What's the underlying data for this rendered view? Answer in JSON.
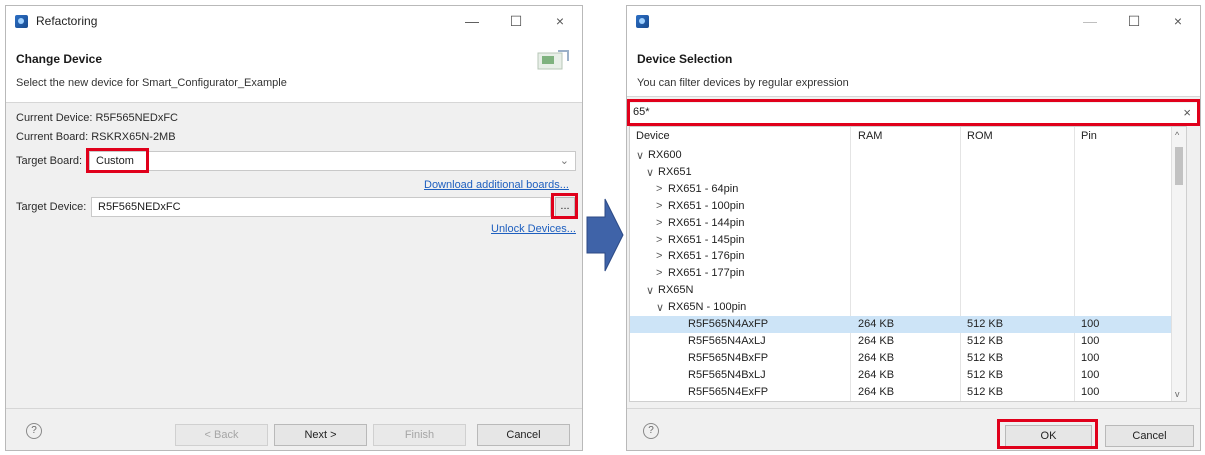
{
  "left_dialog": {
    "title": "Refactoring",
    "heading": "Change Device",
    "subtitle": "Select the new device for Smart_Configurator_Example",
    "current_device_label": "Current Device: R5F565NEDxFC",
    "current_board_label": "Current Board: RSKRX65N-2MB",
    "target_board_label": "Target Board:",
    "target_board_value": "Custom",
    "download_link": "Download additional boards...",
    "target_device_label": "Target Device:",
    "target_device_value": "R5F565NEDxFC",
    "browse_label": "...",
    "unlock_link": "Unlock Devices...",
    "buttons": {
      "back": "< Back",
      "next": "Next >",
      "finish": "Finish",
      "cancel": "Cancel"
    },
    "help_icon": "?"
  },
  "right_dialog": {
    "heading": "Device Selection",
    "subtitle": "You can filter devices by regular expression",
    "filter_value": "65*",
    "clear_label": "×",
    "columns": [
      "Device",
      "RAM",
      "ROM",
      "Pin"
    ],
    "rows": [
      {
        "device": "RX600",
        "ram": "",
        "rom": "",
        "pin": "",
        "indent": 0,
        "expander": "∨"
      },
      {
        "device": "RX651",
        "ram": "",
        "rom": "",
        "pin": "",
        "indent": 1,
        "expander": "∨"
      },
      {
        "device": "RX651 - 64pin",
        "ram": "",
        "rom": "",
        "pin": "",
        "indent": 2,
        "expander": ">"
      },
      {
        "device": "RX651 - 100pin",
        "ram": "",
        "rom": "",
        "pin": "",
        "indent": 2,
        "expander": ">"
      },
      {
        "device": "RX651 - 144pin",
        "ram": "",
        "rom": "",
        "pin": "",
        "indent": 2,
        "expander": ">"
      },
      {
        "device": "RX651 - 145pin",
        "ram": "",
        "rom": "",
        "pin": "",
        "indent": 2,
        "expander": ">"
      },
      {
        "device": "RX651 - 176pin",
        "ram": "",
        "rom": "",
        "pin": "",
        "indent": 2,
        "expander": ">"
      },
      {
        "device": "RX651 - 177pin",
        "ram": "",
        "rom": "",
        "pin": "",
        "indent": 2,
        "expander": ">"
      },
      {
        "device": "RX65N",
        "ram": "",
        "rom": "",
        "pin": "",
        "indent": 1,
        "expander": "∨"
      },
      {
        "device": "RX65N - 100pin",
        "ram": "",
        "rom": "",
        "pin": "",
        "indent": 2,
        "expander": "∨"
      },
      {
        "device": "R5F565N4AxFP",
        "ram": "264 KB",
        "rom": "512 KB",
        "pin": "100",
        "indent": 3,
        "expander": "",
        "selected": true
      },
      {
        "device": "R5F565N4AxLJ",
        "ram": "264 KB",
        "rom": "512 KB",
        "pin": "100",
        "indent": 3,
        "expander": ""
      },
      {
        "device": "R5F565N4BxFP",
        "ram": "264 KB",
        "rom": "512 KB",
        "pin": "100",
        "indent": 3,
        "expander": ""
      },
      {
        "device": "R5F565N4BxLJ",
        "ram": "264 KB",
        "rom": "512 KB",
        "pin": "100",
        "indent": 3,
        "expander": ""
      },
      {
        "device": "R5F565N4ExFP",
        "ram": "264 KB",
        "rom": "512 KB",
        "pin": "100",
        "indent": 3,
        "expander": ""
      }
    ],
    "buttons": {
      "ok": "OK",
      "cancel": "Cancel"
    },
    "help_icon": "?"
  },
  "window_controls": {
    "minimize": "—",
    "maximize": "☐",
    "close": "×"
  },
  "colors": {
    "highlight": "#e0001b",
    "arrow": "#3f63a8",
    "selection": "#cde4f7",
    "link": "#1e5fbf"
  }
}
